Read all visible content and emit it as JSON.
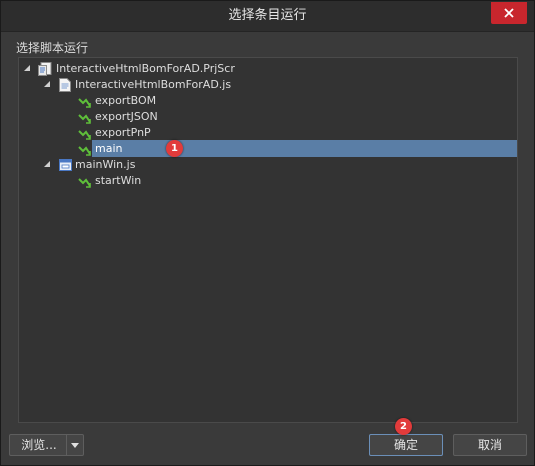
{
  "window": {
    "title": "选择条目运行"
  },
  "section_label": "选择脚本运行",
  "tree": [
    {
      "label": "InteractiveHtmlBomForAD.PrjScr",
      "level": 0,
      "icon": "project-icon",
      "expanded": true
    },
    {
      "label": "InteractiveHtmlBomForAD.js",
      "level": 1,
      "icon": "script-file-icon",
      "expanded": true
    },
    {
      "label": "exportBOM",
      "level": 2,
      "icon": "procedure-icon"
    },
    {
      "label": "exportJSON",
      "level": 2,
      "icon": "procedure-icon"
    },
    {
      "label": "exportPnP",
      "level": 2,
      "icon": "procedure-icon"
    },
    {
      "label": "main",
      "level": 2,
      "icon": "procedure-icon",
      "selected": true
    },
    {
      "label": "mainWin.js",
      "level": 1,
      "icon": "form-file-icon",
      "expanded": true
    },
    {
      "label": "startWin",
      "level": 2,
      "icon": "procedure-icon"
    }
  ],
  "annotations": {
    "badge1": "1",
    "badge2": "2"
  },
  "buttons": {
    "browse": "浏览...",
    "ok": "确定",
    "cancel": "取消"
  },
  "colors": {
    "selection": "#5a7ea6",
    "close": "#c8262d",
    "badge": "#e23b3b",
    "procedure_icon": "#5fbf3a"
  }
}
